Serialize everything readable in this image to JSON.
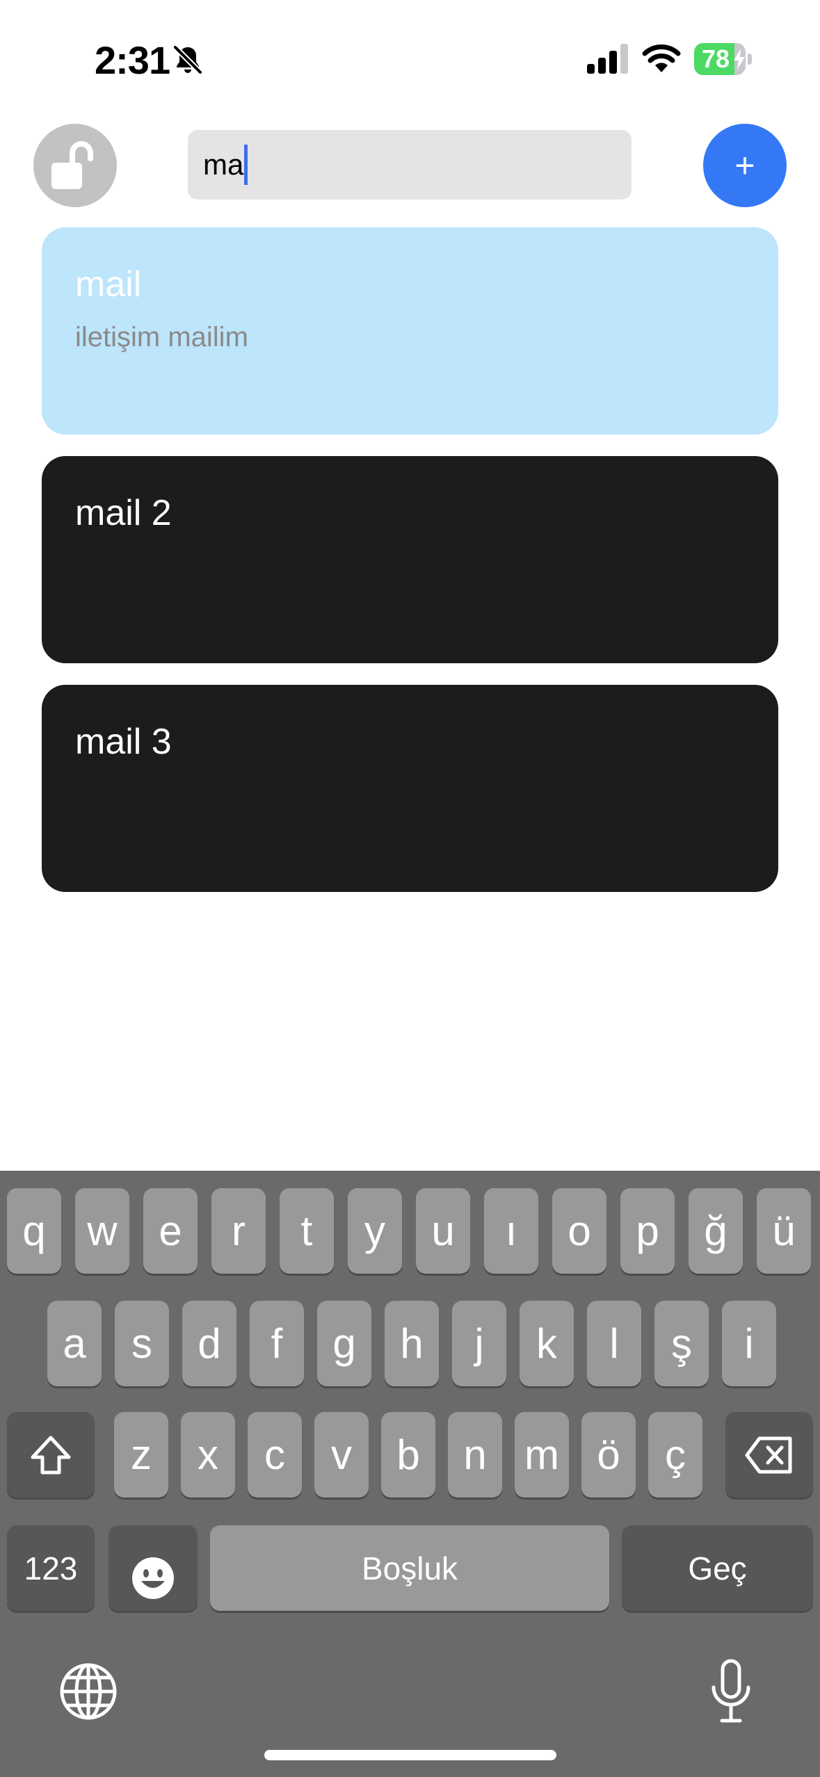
{
  "status_bar": {
    "time": "2:31",
    "battery_level": "78",
    "battery_fraction": 0.78,
    "battery_color": "#4cd964"
  },
  "toolbar": {
    "lock_icon": "unlock-icon",
    "search_value": "ma",
    "add_label": "+",
    "accent_color": "#3478f6"
  },
  "cards": [
    {
      "title": "mail",
      "description": "iletişim mailim",
      "selected": true
    },
    {
      "title": "mail 2",
      "description": "",
      "selected": false
    },
    {
      "title": "mail 3",
      "description": "",
      "selected": false
    }
  ],
  "keyboard": {
    "row1": [
      "q",
      "w",
      "e",
      "r",
      "t",
      "y",
      "u",
      "ı",
      "o",
      "p",
      "ğ",
      "ü"
    ],
    "row2": [
      "a",
      "s",
      "d",
      "f",
      "g",
      "h",
      "j",
      "k",
      "l",
      "ş",
      "i"
    ],
    "row3": [
      "z",
      "x",
      "c",
      "v",
      "b",
      "n",
      "m",
      "ö",
      "ç"
    ],
    "numbers_label": "123",
    "space_label": "Boşluk",
    "return_label": "Geç",
    "icons": [
      "shift-icon",
      "backspace-icon",
      "emoji-icon",
      "globe-icon",
      "microphone-icon"
    ]
  }
}
